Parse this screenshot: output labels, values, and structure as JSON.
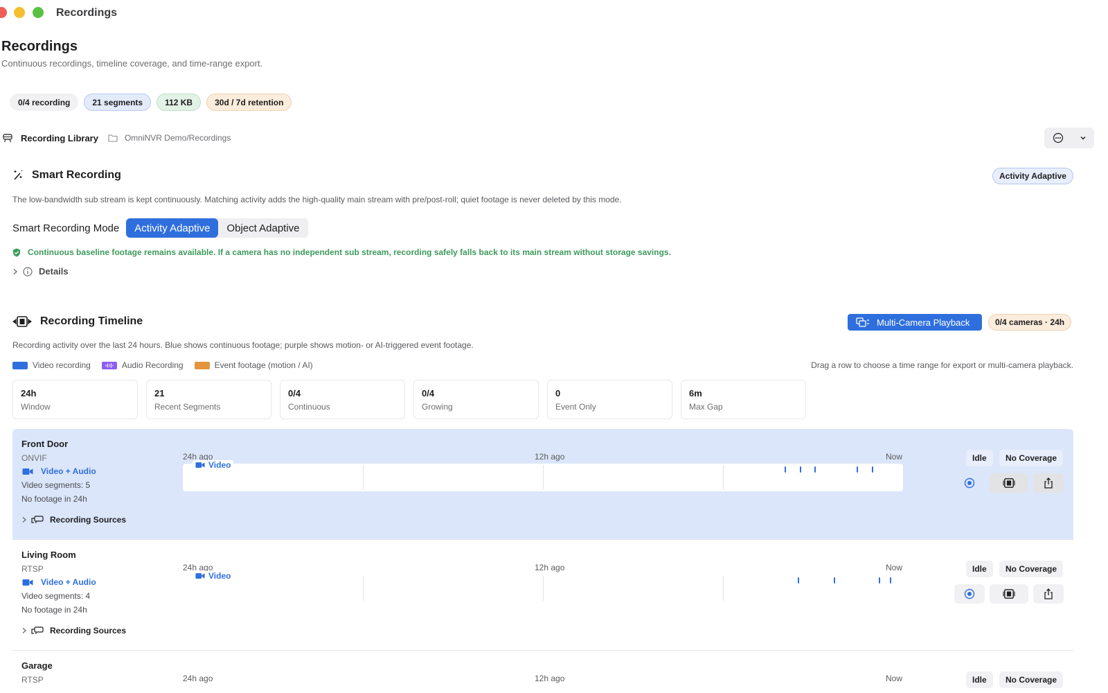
{
  "window": {
    "title": "Recordings"
  },
  "header": {
    "title": "Recordings",
    "subtitle": "Continuous recordings, timeline coverage, and time-range export."
  },
  "summary_pills": [
    "0/4 recording",
    "21 segments",
    "112 KB",
    "30d / 7d retention"
  ],
  "library": {
    "label": "Recording Library",
    "path": "OmniNVR Demo/Recordings"
  },
  "smart": {
    "title": "Smart Recording",
    "badge": "Activity Adaptive",
    "description": "The low-bandwidth sub stream is kept continuously. Matching activity adds the high-quality main stream with pre/post-roll; quiet footage is never deleted by this mode.",
    "mode_label": "Smart Recording Mode",
    "modes": [
      "Activity Adaptive",
      "Object Adaptive"
    ],
    "selected_mode": "Activity Adaptive",
    "notice": "Continuous baseline footage remains available. If a camera has no independent sub stream, recording safely falls back to its main stream without storage savings.",
    "details_label": "Details"
  },
  "timeline": {
    "title": "Recording Timeline",
    "playback_button": "Multi-Camera Playback",
    "badge": "0/4 cameras · 24h",
    "description": "Recording activity over the last 24 hours. Blue shows continuous footage; purple shows motion- or AI-triggered event footage.",
    "legend": [
      {
        "label": "Video recording",
        "color": "#2f6fdd"
      },
      {
        "label": "Audio Recording",
        "color": "#8b5cf6"
      },
      {
        "label": "Event footage (motion / AI)",
        "color": "#e3963e"
      }
    ],
    "drag_hint": "Drag a row to choose a time range for export or multi-camera playback.",
    "stats": [
      {
        "value": "24h",
        "label": "Window"
      },
      {
        "value": "21",
        "label": "Recent Segments"
      },
      {
        "value": "0/4",
        "label": "Continuous"
      },
      {
        "value": "0/4",
        "label": "Growing"
      },
      {
        "value": "0",
        "label": "Event Only"
      },
      {
        "value": "6m",
        "label": "Max Gap"
      }
    ],
    "axis_labels": {
      "start": "24h ago",
      "mid": "12h ago",
      "end": "Now"
    },
    "track_chip": "Video",
    "sources_label": "Recording Sources",
    "cameras": [
      {
        "name": "Front Door",
        "protocol": "ONVIF",
        "media": "Video + Audio",
        "segments": "Video segments: 5",
        "footage": "No footage in 24h",
        "status": "Idle",
        "coverage": "No Coverage",
        "segment_positions_hours_ago": [
          3.95,
          3.45,
          2.95,
          1.55,
          1.05
        ]
      },
      {
        "name": "Living Room",
        "protocol": "RTSP",
        "media": "Video + Audio",
        "segments": "Video segments: 4",
        "footage": "No footage in 24h",
        "status": "Idle",
        "coverage": "No Coverage",
        "segment_positions_hours_ago": [
          3.5,
          2.3,
          0.8,
          0.45
        ]
      },
      {
        "name": "Garage",
        "protocol": "RTSP",
        "status": "Idle",
        "coverage": "No Coverage"
      }
    ]
  }
}
